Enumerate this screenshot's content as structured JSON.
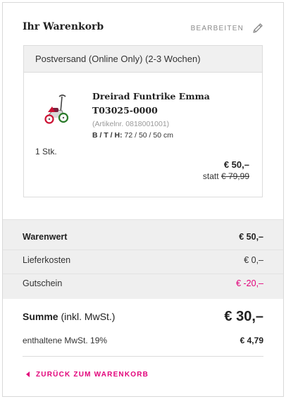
{
  "header": {
    "title": "Ihr Warenkorb",
    "edit_label": "BEARBEITEN"
  },
  "shipping": {
    "label": "Postversand (Online Only) (2-3 Wochen)"
  },
  "item": {
    "name": "Dreirad Funtrike Emma T03025-0000",
    "article_no": "(Artikelnr. 0818001001)",
    "dims_label": "B / T / H:",
    "dims_value": "72 / 50 / 50 cm",
    "quantity": "1 Stk.",
    "price": "€ 50,–",
    "old_price_prefix": "statt",
    "old_price": "€ 79,99"
  },
  "totals": {
    "rows": [
      {
        "label": "Warenwert",
        "value": "€ 50,–"
      },
      {
        "label": "Lieferkosten",
        "value": "€ 0,–"
      },
      {
        "label": "Gutschein",
        "value": "€ -20,–"
      }
    ],
    "sum_label": "Summe",
    "sum_note": "(inkl. MwSt.)",
    "sum_value": "€ 30,–",
    "vat_label": "enthaltene MwSt. 19%",
    "vat_value": "€ 4,79"
  },
  "back_link": {
    "label": "ZURÜCK ZUM WARENKORB"
  },
  "colors": {
    "accent": "#e2007a",
    "panel": "#efefef",
    "border": "#dcdcdc"
  },
  "icons": {
    "edit": "pencil-icon",
    "back": "caret-left-icon"
  }
}
